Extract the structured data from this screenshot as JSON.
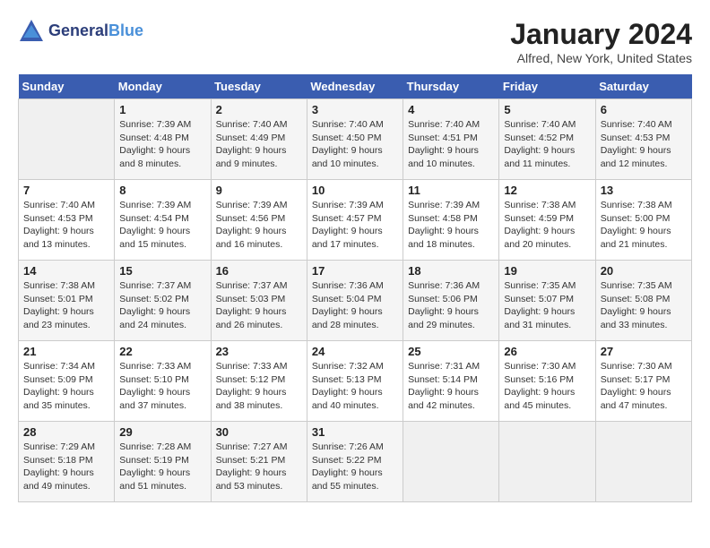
{
  "header": {
    "logo_line1": "General",
    "logo_line2": "Blue",
    "title": "January 2024",
    "subtitle": "Alfred, New York, United States"
  },
  "calendar": {
    "days_of_week": [
      "Sunday",
      "Monday",
      "Tuesday",
      "Wednesday",
      "Thursday",
      "Friday",
      "Saturday"
    ],
    "weeks": [
      [
        {
          "day": "",
          "info": ""
        },
        {
          "day": "1",
          "info": "Sunrise: 7:39 AM\nSunset: 4:48 PM\nDaylight: 9 hours\nand 8 minutes."
        },
        {
          "day": "2",
          "info": "Sunrise: 7:40 AM\nSunset: 4:49 PM\nDaylight: 9 hours\nand 9 minutes."
        },
        {
          "day": "3",
          "info": "Sunrise: 7:40 AM\nSunset: 4:50 PM\nDaylight: 9 hours\nand 10 minutes."
        },
        {
          "day": "4",
          "info": "Sunrise: 7:40 AM\nSunset: 4:51 PM\nDaylight: 9 hours\nand 10 minutes."
        },
        {
          "day": "5",
          "info": "Sunrise: 7:40 AM\nSunset: 4:52 PM\nDaylight: 9 hours\nand 11 minutes."
        },
        {
          "day": "6",
          "info": "Sunrise: 7:40 AM\nSunset: 4:53 PM\nDaylight: 9 hours\nand 12 minutes."
        }
      ],
      [
        {
          "day": "7",
          "info": "Sunrise: 7:40 AM\nSunset: 4:53 PM\nDaylight: 9 hours\nand 13 minutes."
        },
        {
          "day": "8",
          "info": "Sunrise: 7:39 AM\nSunset: 4:54 PM\nDaylight: 9 hours\nand 15 minutes."
        },
        {
          "day": "9",
          "info": "Sunrise: 7:39 AM\nSunset: 4:56 PM\nDaylight: 9 hours\nand 16 minutes."
        },
        {
          "day": "10",
          "info": "Sunrise: 7:39 AM\nSunset: 4:57 PM\nDaylight: 9 hours\nand 17 minutes."
        },
        {
          "day": "11",
          "info": "Sunrise: 7:39 AM\nSunset: 4:58 PM\nDaylight: 9 hours\nand 18 minutes."
        },
        {
          "day": "12",
          "info": "Sunrise: 7:38 AM\nSunset: 4:59 PM\nDaylight: 9 hours\nand 20 minutes."
        },
        {
          "day": "13",
          "info": "Sunrise: 7:38 AM\nSunset: 5:00 PM\nDaylight: 9 hours\nand 21 minutes."
        }
      ],
      [
        {
          "day": "14",
          "info": "Sunrise: 7:38 AM\nSunset: 5:01 PM\nDaylight: 9 hours\nand 23 minutes."
        },
        {
          "day": "15",
          "info": "Sunrise: 7:37 AM\nSunset: 5:02 PM\nDaylight: 9 hours\nand 24 minutes."
        },
        {
          "day": "16",
          "info": "Sunrise: 7:37 AM\nSunset: 5:03 PM\nDaylight: 9 hours\nand 26 minutes."
        },
        {
          "day": "17",
          "info": "Sunrise: 7:36 AM\nSunset: 5:04 PM\nDaylight: 9 hours\nand 28 minutes."
        },
        {
          "day": "18",
          "info": "Sunrise: 7:36 AM\nSunset: 5:06 PM\nDaylight: 9 hours\nand 29 minutes."
        },
        {
          "day": "19",
          "info": "Sunrise: 7:35 AM\nSunset: 5:07 PM\nDaylight: 9 hours\nand 31 minutes."
        },
        {
          "day": "20",
          "info": "Sunrise: 7:35 AM\nSunset: 5:08 PM\nDaylight: 9 hours\nand 33 minutes."
        }
      ],
      [
        {
          "day": "21",
          "info": "Sunrise: 7:34 AM\nSunset: 5:09 PM\nDaylight: 9 hours\nand 35 minutes."
        },
        {
          "day": "22",
          "info": "Sunrise: 7:33 AM\nSunset: 5:10 PM\nDaylight: 9 hours\nand 37 minutes."
        },
        {
          "day": "23",
          "info": "Sunrise: 7:33 AM\nSunset: 5:12 PM\nDaylight: 9 hours\nand 38 minutes."
        },
        {
          "day": "24",
          "info": "Sunrise: 7:32 AM\nSunset: 5:13 PM\nDaylight: 9 hours\nand 40 minutes."
        },
        {
          "day": "25",
          "info": "Sunrise: 7:31 AM\nSunset: 5:14 PM\nDaylight: 9 hours\nand 42 minutes."
        },
        {
          "day": "26",
          "info": "Sunrise: 7:30 AM\nSunset: 5:16 PM\nDaylight: 9 hours\nand 45 minutes."
        },
        {
          "day": "27",
          "info": "Sunrise: 7:30 AM\nSunset: 5:17 PM\nDaylight: 9 hours\nand 47 minutes."
        }
      ],
      [
        {
          "day": "28",
          "info": "Sunrise: 7:29 AM\nSunset: 5:18 PM\nDaylight: 9 hours\nand 49 minutes."
        },
        {
          "day": "29",
          "info": "Sunrise: 7:28 AM\nSunset: 5:19 PM\nDaylight: 9 hours\nand 51 minutes."
        },
        {
          "day": "30",
          "info": "Sunrise: 7:27 AM\nSunset: 5:21 PM\nDaylight: 9 hours\nand 53 minutes."
        },
        {
          "day": "31",
          "info": "Sunrise: 7:26 AM\nSunset: 5:22 PM\nDaylight: 9 hours\nand 55 minutes."
        },
        {
          "day": "",
          "info": ""
        },
        {
          "day": "",
          "info": ""
        },
        {
          "day": "",
          "info": ""
        }
      ]
    ]
  }
}
